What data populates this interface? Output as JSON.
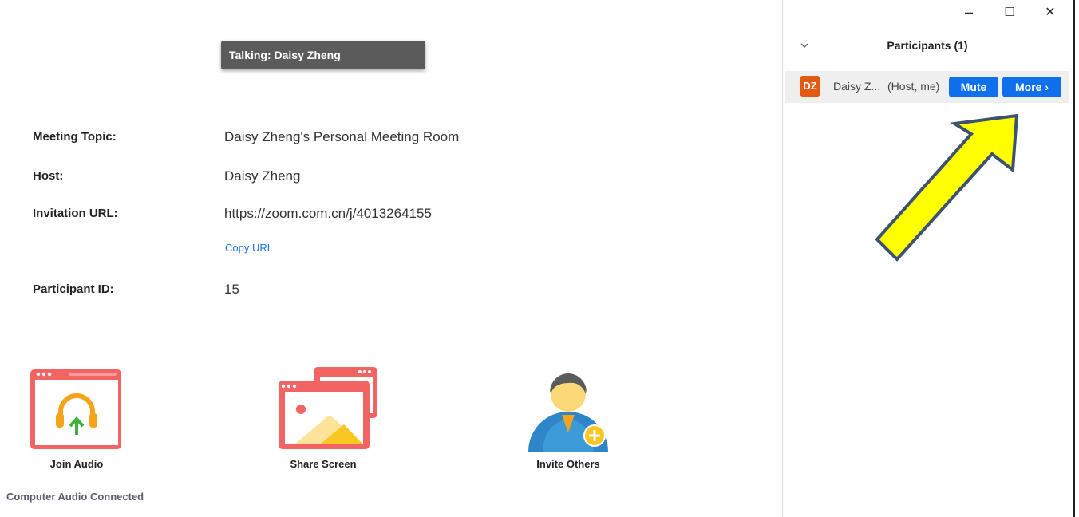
{
  "talking_indicator": "Talking: Daisy Zheng",
  "meeting_info": {
    "topic_label": "Meeting Topic:",
    "topic_value": "Daisy Zheng's Personal Meeting Room",
    "host_label": "Host:",
    "host_value": "Daisy Zheng",
    "url_label": "Invitation URL:",
    "url_value": "https://zoom.com.cn/j/4013264155",
    "copy_url": "Copy URL",
    "participant_id_label": "Participant ID:",
    "participant_id_value": "15"
  },
  "tools": {
    "join_audio": "Join Audio",
    "share_screen": "Share Screen",
    "invite_others": "Invite Others",
    "audio_status": "Computer Audio Connected"
  },
  "window_controls": {
    "minimize": "–",
    "maximize": "☐",
    "close": "✕"
  },
  "participants_panel": {
    "title": "Participants (1)",
    "participant": {
      "initials": "DZ",
      "name": "Daisy Z...",
      "role": "(Host, me)",
      "mute_label": "Mute",
      "more_label": "More ›"
    }
  },
  "colors": {
    "accent_blue": "#0e71eb",
    "avatar_orange": "#e05a12",
    "icon_red": "#f26363",
    "annotation_arrow": "#ffff00",
    "talking_banner": "#5b5b5b"
  },
  "icons": [
    "chevron-down-icon",
    "join-audio-icon",
    "share-screen-icon",
    "invite-others-icon",
    "annotation-arrow"
  ]
}
